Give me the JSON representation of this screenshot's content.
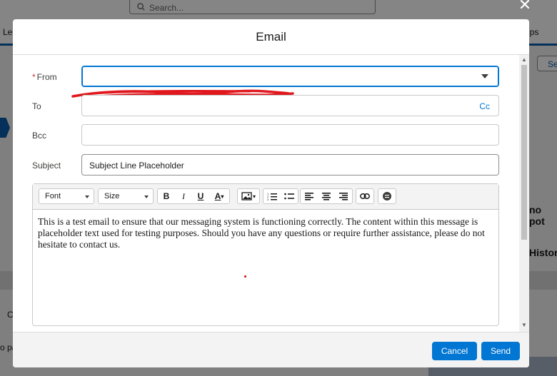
{
  "background": {
    "search_placeholder": "Search...",
    "nav_left": "Lea",
    "nav_right": "ups",
    "right_button": "Se",
    "right_text_1": "no pot",
    "right_text_2": "Histor",
    "left_text_1": "C",
    "left_text_2": "o pa"
  },
  "modal": {
    "title": "Email",
    "fields": {
      "from_label": "From",
      "from_required_mark": "*",
      "to_label": "To",
      "to_cc": "Cc",
      "bcc_label": "Bcc",
      "subject_label": "Subject",
      "subject_value": "Subject Line Placeholder"
    },
    "toolbar": {
      "font_label": "Font",
      "size_label": "Size",
      "icons": [
        "bold-icon",
        "italic-icon",
        "underline-icon",
        "text-color-icon",
        "image-icon",
        "numbered-list-icon",
        "bulleted-list-icon",
        "align-left-icon",
        "align-center-icon",
        "align-right-icon",
        "link-icon",
        "merge-field-icon"
      ]
    },
    "body_text": "This is a test email to ensure that our messaging system is functioning correctly. The content within this message is placeholder text used for testing purposes. Should you have any questions or require further assistance, please do not hesitate to contact us.",
    "buttons": {
      "cancel": "Cancel",
      "send": "Send"
    }
  },
  "colors": {
    "brand": "#0176d3",
    "redaction": "#e0181e",
    "required": "#c23934"
  }
}
